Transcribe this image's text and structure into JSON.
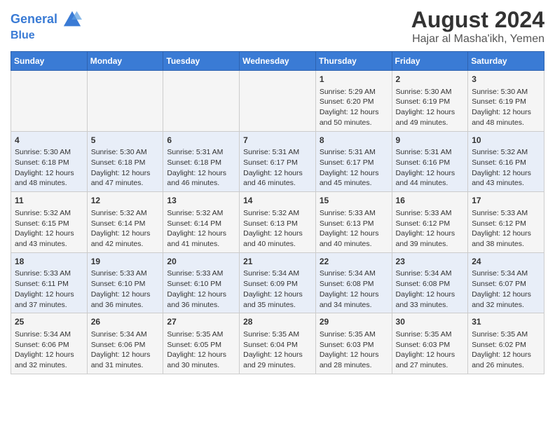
{
  "header": {
    "logo_line1": "General",
    "logo_line2": "Blue",
    "title": "August 2024",
    "subtitle": "Hajar al Masha'ikh, Yemen"
  },
  "days_of_week": [
    "Sunday",
    "Monday",
    "Tuesday",
    "Wednesday",
    "Thursday",
    "Friday",
    "Saturday"
  ],
  "weeks": [
    [
      {
        "day": "",
        "text": ""
      },
      {
        "day": "",
        "text": ""
      },
      {
        "day": "",
        "text": ""
      },
      {
        "day": "",
        "text": ""
      },
      {
        "day": "1",
        "text": "Sunrise: 5:29 AM\nSunset: 6:20 PM\nDaylight: 12 hours\nand 50 minutes."
      },
      {
        "day": "2",
        "text": "Sunrise: 5:30 AM\nSunset: 6:19 PM\nDaylight: 12 hours\nand 49 minutes."
      },
      {
        "day": "3",
        "text": "Sunrise: 5:30 AM\nSunset: 6:19 PM\nDaylight: 12 hours\nand 48 minutes."
      }
    ],
    [
      {
        "day": "4",
        "text": "Sunrise: 5:30 AM\nSunset: 6:18 PM\nDaylight: 12 hours\nand 48 minutes."
      },
      {
        "day": "5",
        "text": "Sunrise: 5:30 AM\nSunset: 6:18 PM\nDaylight: 12 hours\nand 47 minutes."
      },
      {
        "day": "6",
        "text": "Sunrise: 5:31 AM\nSunset: 6:18 PM\nDaylight: 12 hours\nand 46 minutes."
      },
      {
        "day": "7",
        "text": "Sunrise: 5:31 AM\nSunset: 6:17 PM\nDaylight: 12 hours\nand 46 minutes."
      },
      {
        "day": "8",
        "text": "Sunrise: 5:31 AM\nSunset: 6:17 PM\nDaylight: 12 hours\nand 45 minutes."
      },
      {
        "day": "9",
        "text": "Sunrise: 5:31 AM\nSunset: 6:16 PM\nDaylight: 12 hours\nand 44 minutes."
      },
      {
        "day": "10",
        "text": "Sunrise: 5:32 AM\nSunset: 6:16 PM\nDaylight: 12 hours\nand 43 minutes."
      }
    ],
    [
      {
        "day": "11",
        "text": "Sunrise: 5:32 AM\nSunset: 6:15 PM\nDaylight: 12 hours\nand 43 minutes."
      },
      {
        "day": "12",
        "text": "Sunrise: 5:32 AM\nSunset: 6:14 PM\nDaylight: 12 hours\nand 42 minutes."
      },
      {
        "day": "13",
        "text": "Sunrise: 5:32 AM\nSunset: 6:14 PM\nDaylight: 12 hours\nand 41 minutes."
      },
      {
        "day": "14",
        "text": "Sunrise: 5:32 AM\nSunset: 6:13 PM\nDaylight: 12 hours\nand 40 minutes."
      },
      {
        "day": "15",
        "text": "Sunrise: 5:33 AM\nSunset: 6:13 PM\nDaylight: 12 hours\nand 40 minutes."
      },
      {
        "day": "16",
        "text": "Sunrise: 5:33 AM\nSunset: 6:12 PM\nDaylight: 12 hours\nand 39 minutes."
      },
      {
        "day": "17",
        "text": "Sunrise: 5:33 AM\nSunset: 6:12 PM\nDaylight: 12 hours\nand 38 minutes."
      }
    ],
    [
      {
        "day": "18",
        "text": "Sunrise: 5:33 AM\nSunset: 6:11 PM\nDaylight: 12 hours\nand 37 minutes."
      },
      {
        "day": "19",
        "text": "Sunrise: 5:33 AM\nSunset: 6:10 PM\nDaylight: 12 hours\nand 36 minutes."
      },
      {
        "day": "20",
        "text": "Sunrise: 5:33 AM\nSunset: 6:10 PM\nDaylight: 12 hours\nand 36 minutes."
      },
      {
        "day": "21",
        "text": "Sunrise: 5:34 AM\nSunset: 6:09 PM\nDaylight: 12 hours\nand 35 minutes."
      },
      {
        "day": "22",
        "text": "Sunrise: 5:34 AM\nSunset: 6:08 PM\nDaylight: 12 hours\nand 34 minutes."
      },
      {
        "day": "23",
        "text": "Sunrise: 5:34 AM\nSunset: 6:08 PM\nDaylight: 12 hours\nand 33 minutes."
      },
      {
        "day": "24",
        "text": "Sunrise: 5:34 AM\nSunset: 6:07 PM\nDaylight: 12 hours\nand 32 minutes."
      }
    ],
    [
      {
        "day": "25",
        "text": "Sunrise: 5:34 AM\nSunset: 6:06 PM\nDaylight: 12 hours\nand 32 minutes."
      },
      {
        "day": "26",
        "text": "Sunrise: 5:34 AM\nSunset: 6:06 PM\nDaylight: 12 hours\nand 31 minutes."
      },
      {
        "day": "27",
        "text": "Sunrise: 5:35 AM\nSunset: 6:05 PM\nDaylight: 12 hours\nand 30 minutes."
      },
      {
        "day": "28",
        "text": "Sunrise: 5:35 AM\nSunset: 6:04 PM\nDaylight: 12 hours\nand 29 minutes."
      },
      {
        "day": "29",
        "text": "Sunrise: 5:35 AM\nSunset: 6:03 PM\nDaylight: 12 hours\nand 28 minutes."
      },
      {
        "day": "30",
        "text": "Sunrise: 5:35 AM\nSunset: 6:03 PM\nDaylight: 12 hours\nand 27 minutes."
      },
      {
        "day": "31",
        "text": "Sunrise: 5:35 AM\nSunset: 6:02 PM\nDaylight: 12 hours\nand 26 minutes."
      }
    ]
  ]
}
